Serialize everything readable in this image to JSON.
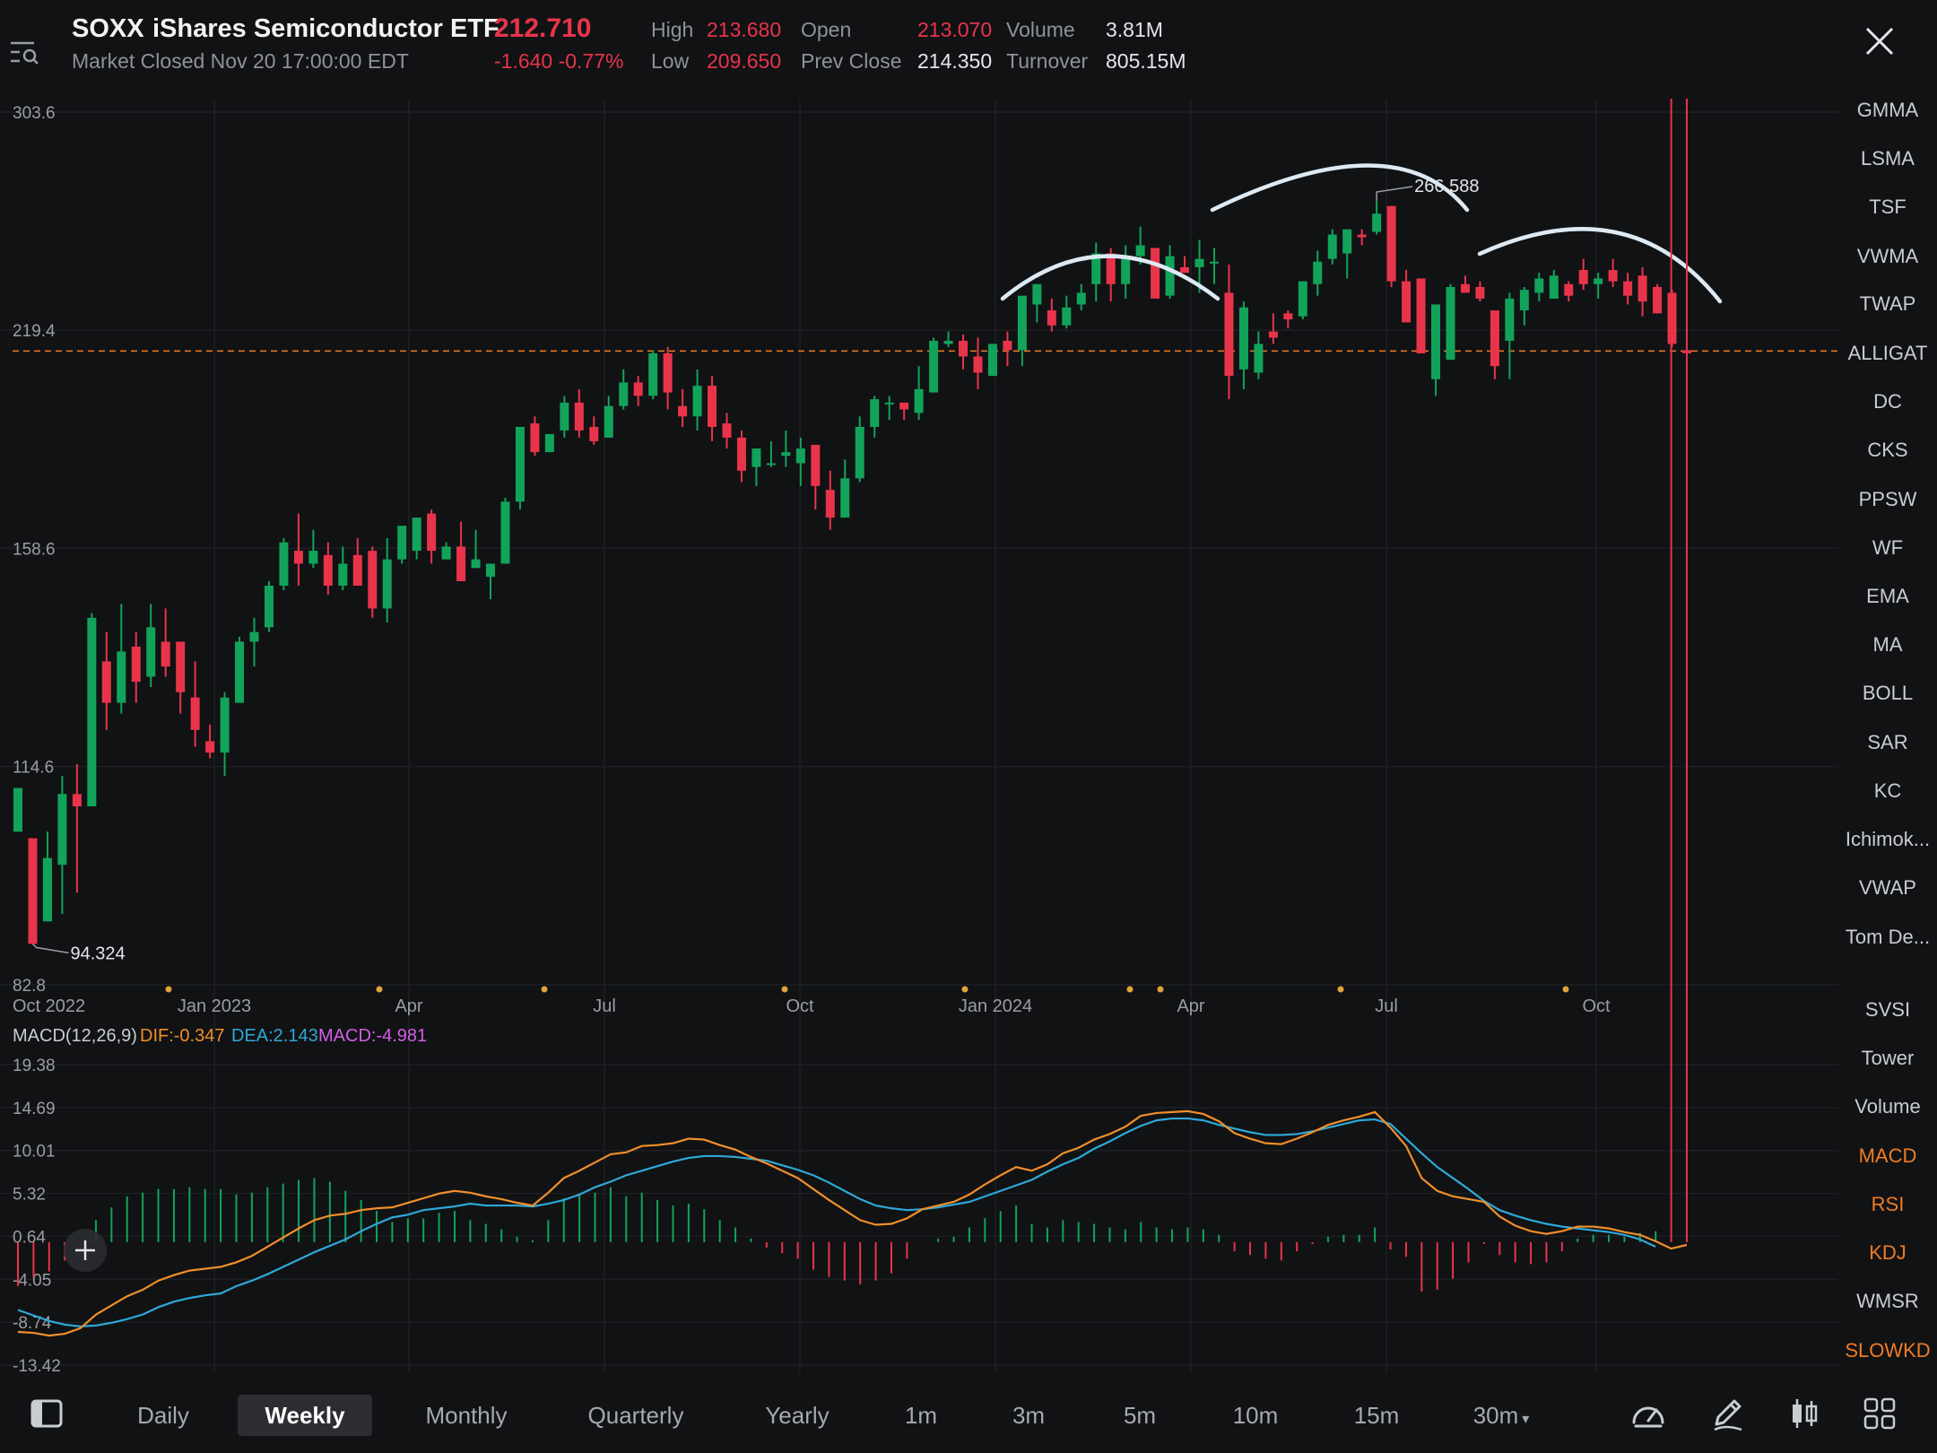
{
  "header": {
    "symbol": "SOXX",
    "name": "iShares Semiconductor ETF",
    "price": "212.710",
    "status": "Market Closed Nov 20 17:00:00 EDT",
    "change": "-1.640 -0.77%",
    "stats": [
      {
        "label": "High",
        "value": "213.680",
        "color": "#e8344b"
      },
      {
        "label": "Low",
        "value": "209.650",
        "color": "#e8344b"
      },
      {
        "label": "Open",
        "value": "213.070",
        "color": "#e8344b"
      },
      {
        "label": "Prev Close",
        "value": "214.350",
        "color": "#e4e6ea"
      },
      {
        "label": "Volume",
        "value": "3.81M",
        "color": "#e4e6ea"
      },
      {
        "label": "Turnover",
        "value": "805.15M",
        "color": "#e4e6ea"
      }
    ]
  },
  "colors": {
    "up": "#12a35a",
    "down": "#e8344b",
    "accent": "#f07c24",
    "dif": "#f08f2a",
    "dea": "#2ea8d8",
    "macd": "#d35ee3"
  },
  "chart_data": [
    {
      "type": "candlestick",
      "series_name": "SOXX Weekly",
      "y_ticks": [
        "303.6",
        "219.4",
        "158.6",
        "114.6",
        "82.8"
      ],
      "x_ticks": [
        "Oct 2022",
        "Jan 2023",
        "Apr",
        "Jul",
        "Oct",
        "Jan 2024",
        "Apr",
        "Jul",
        "Oct"
      ],
      "price_line": 212.71,
      "high_label": "266.588",
      "low_label": "94.324",
      "ohlc": [
        [
          104,
          111,
          104,
          111
        ],
        [
          103,
          103,
          88,
          88
        ],
        [
          91,
          104,
          91,
          100
        ],
        [
          99,
          113,
          92,
          110
        ],
        [
          110,
          115,
          95,
          108
        ],
        [
          108,
          144,
          108,
          143
        ],
        [
          134,
          140,
          121,
          126
        ],
        [
          126,
          146,
          124,
          136
        ],
        [
          137,
          140,
          126,
          130
        ],
        [
          131,
          146,
          129,
          141
        ],
        [
          138,
          145,
          131,
          133
        ],
        [
          138,
          138,
          124,
          128
        ],
        [
          127,
          134,
          118,
          121
        ],
        [
          119,
          122,
          116,
          117
        ],
        [
          117,
          128,
          113,
          127
        ],
        [
          126,
          139,
          126,
          138
        ],
        [
          138,
          143,
          133,
          140
        ],
        [
          141,
          151,
          140,
          150
        ],
        [
          150,
          161,
          149,
          160
        ],
        [
          158,
          167,
          150,
          155
        ],
        [
          155,
          163,
          154,
          158
        ],
        [
          157,
          160,
          148,
          150
        ],
        [
          150,
          159,
          149,
          155
        ],
        [
          157,
          161,
          150,
          150
        ],
        [
          158,
          159,
          143,
          145
        ],
        [
          145,
          161,
          142,
          156
        ],
        [
          156,
          164,
          155,
          164
        ],
        [
          158,
          166,
          156,
          166
        ],
        [
          167,
          168,
          155,
          158
        ],
        [
          156,
          160,
          156,
          159
        ],
        [
          159,
          165,
          151,
          151
        ],
        [
          154,
          163,
          154,
          156
        ],
        [
          152,
          153,
          147,
          155
        ],
        [
          155,
          171,
          155,
          170
        ],
        [
          170,
          190,
          168,
          190
        ],
        [
          191,
          193,
          182,
          183
        ],
        [
          183,
          185,
          183,
          188
        ],
        [
          189,
          199,
          187,
          197
        ],
        [
          197,
          201,
          187,
          189
        ],
        [
          190,
          193,
          185,
          186
        ],
        [
          187,
          199,
          187,
          196
        ],
        [
          196,
          207,
          195,
          203
        ],
        [
          203,
          205,
          196,
          199
        ],
        [
          199,
          213,
          198,
          212
        ],
        [
          212,
          214,
          195,
          200
        ],
        [
          196,
          201,
          190,
          193
        ],
        [
          193,
          207,
          189,
          202
        ],
        [
          202,
          205,
          186,
          190
        ],
        [
          191,
          194,
          184,
          187
        ],
        [
          187,
          189,
          175,
          178
        ],
        [
          179,
          183,
          174,
          184
        ],
        [
          180,
          186,
          179,
          180
        ],
        [
          182,
          189,
          179,
          183
        ],
        [
          180,
          187,
          174,
          184
        ],
        [
          185,
          185,
          168,
          174
        ],
        [
          173,
          178,
          163,
          166
        ],
        [
          166,
          181,
          166,
          176
        ],
        [
          176,
          193,
          175,
          190
        ],
        [
          190,
          199,
          187,
          198
        ],
        [
          197,
          199,
          192,
          197
        ],
        [
          197,
          197,
          192,
          195
        ],
        [
          194,
          208,
          192,
          201
        ],
        [
          200,
          217,
          200,
          216
        ],
        [
          215,
          219,
          214,
          216
        ],
        [
          216,
          218,
          207,
          211
        ],
        [
          211,
          217,
          201,
          206
        ],
        [
          205,
          215,
          205,
          215
        ],
        [
          216,
          219,
          208,
          213
        ],
        [
          213,
          229,
          208,
          231
        ],
        [
          228,
          233,
          222,
          235
        ],
        [
          226,
          230,
          219,
          221
        ],
        [
          221,
          231,
          220,
          227
        ],
        [
          228,
          235,
          226,
          232
        ],
        [
          235,
          250,
          229,
          246
        ],
        [
          246,
          248,
          229,
          235
        ],
        [
          235,
          249,
          230,
          245
        ],
        [
          245,
          256,
          242,
          249
        ],
        [
          248,
          248,
          230,
          230
        ],
        [
          231,
          249,
          230,
          245
        ],
        [
          241,
          245,
          241,
          239
        ],
        [
          241,
          251,
          232,
          244
        ],
        [
          243,
          248,
          235,
          243
        ],
        [
          232,
          242,
          198,
          205
        ],
        [
          207,
          229,
          201,
          227
        ],
        [
          206,
          219,
          204,
          215
        ],
        [
          219,
          225,
          215,
          217
        ],
        [
          225,
          226,
          220,
          223
        ],
        [
          224,
          236,
          223,
          236
        ],
        [
          235,
          247,
          231,
          243
        ],
        [
          244,
          255,
          242,
          253
        ],
        [
          246,
          255,
          237,
          255
        ],
        [
          253,
          255,
          249,
          252
        ],
        [
          254,
          266,
          253,
          261
        ],
        [
          264,
          264,
          234,
          236
        ],
        [
          236,
          240,
          222,
          222
        ],
        [
          237,
          237,
          212,
          212
        ],
        [
          204,
          228,
          199,
          228
        ],
        [
          210,
          235,
          210,
          234
        ],
        [
          235,
          238,
          233,
          232
        ],
        [
          234,
          236,
          229,
          230
        ],
        [
          226,
          226,
          204,
          208
        ],
        [
          216,
          232,
          204,
          230
        ],
        [
          226,
          234,
          221,
          233
        ],
        [
          232,
          239,
          229,
          237
        ],
        [
          230,
          240,
          230,
          238
        ],
        [
          235,
          236,
          229,
          231
        ],
        [
          240,
          244,
          233,
          235
        ],
        [
          235,
          239,
          230,
          237
        ],
        [
          240,
          244,
          234,
          236
        ],
        [
          236,
          239,
          228,
          231
        ],
        [
          238,
          241,
          224,
          229
        ],
        [
          234,
          235,
          225,
          225
        ],
        [
          232,
          233,
          214,
          215
        ],
        [
          213,
          215,
          209,
          212
        ]
      ]
    },
    {
      "type": "line+bar",
      "title": "MACD(12,26,9)",
      "dif_label": "DIF:-0.347",
      "dea_label": "DEA:2.143",
      "macd_label": "MACD:-4.981",
      "y_ticks": [
        "19.38",
        "14.69",
        "10.01",
        "5.32",
        "0.64",
        "-4.05",
        "-8.74",
        "-13.42"
      ],
      "dif": [
        -9.8,
        -9.9,
        -10.2,
        -10.0,
        -9.4,
        -7.9,
        -6.9,
        -5.9,
        -5.2,
        -4.2,
        -3.6,
        -3.1,
        -2.9,
        -2.7,
        -2.2,
        -1.5,
        -0.5,
        0.5,
        1.5,
        2.4,
        2.9,
        3.1,
        3.5,
        3.7,
        3.8,
        4.3,
        4.8,
        5.3,
        5.6,
        5.4,
        5.0,
        4.7,
        4.3,
        4.0,
        5.4,
        7.0,
        7.8,
        8.7,
        9.6,
        9.8,
        10.5,
        10.6,
        10.8,
        11.3,
        11.2,
        10.6,
        10.1,
        9.3,
        8.6,
        7.8,
        7.0,
        5.8,
        4.6,
        3.5,
        2.4,
        1.9,
        2.0,
        2.6,
        3.6,
        4.0,
        4.4,
        5.2,
        6.3,
        7.3,
        8.2,
        7.8,
        8.5,
        9.7,
        10.3,
        11.2,
        11.8,
        12.6,
        13.8,
        14.1,
        14.2,
        14.3,
        14.0,
        13.2,
        11.9,
        11.3,
        10.8,
        10.7,
        11.3,
        12.0,
        12.8,
        13.3,
        13.7,
        14.2,
        12.5,
        10.5,
        7.0,
        5.6,
        5.0,
        4.7,
        4.4,
        2.8,
        1.8,
        1.2,
        0.9,
        1.2,
        1.7,
        1.7,
        1.5,
        1.1,
        0.8,
        0.1,
        -0.7,
        -0.3
      ],
      "dea": [
        -7.4,
        -8.0,
        -8.6,
        -9.0,
        -9.2,
        -9.1,
        -8.8,
        -8.4,
        -7.9,
        -7.1,
        -6.5,
        -6.1,
        -5.8,
        -5.6,
        -4.8,
        -4.2,
        -3.5,
        -2.7,
        -1.9,
        -1.1,
        -0.4,
        0.3,
        1.2,
        2.0,
        2.7,
        3.0,
        3.5,
        3.7,
        3.9,
        4.2,
        4.0,
        4.0,
        4.0,
        3.9,
        4.2,
        4.6,
        5.2,
        6.0,
        6.6,
        7.3,
        7.8,
        8.3,
        8.8,
        9.2,
        9.4,
        9.4,
        9.3,
        9.1,
        8.9,
        8.4,
        7.9,
        7.3,
        6.5,
        5.6,
        4.7,
        4.0,
        3.7,
        3.5,
        3.6,
        3.8,
        4.1,
        4.4,
        5.0,
        5.6,
        6.2,
        6.8,
        7.7,
        8.5,
        9.2,
        10.2,
        11.0,
        11.9,
        12.7,
        13.3,
        13.5,
        13.5,
        13.3,
        12.8,
        12.4,
        12.0,
        11.7,
        11.7,
        11.8,
        12.1,
        12.5,
        12.9,
        13.3,
        13.4,
        12.9,
        11.3,
        9.7,
        8.2,
        7.0,
        5.8,
        4.5,
        3.5,
        2.9,
        2.4,
        2.0,
        1.7,
        1.5,
        1.3,
        1.1,
        0.8,
        0.3,
        -0.5
      ]
    }
  ],
  "side_indicators": [
    {
      "label": "GMMA",
      "active": false
    },
    {
      "label": "LSMA",
      "active": false
    },
    {
      "label": "TSF",
      "active": false
    },
    {
      "label": "VWMA",
      "active": false
    },
    {
      "label": "TWAP",
      "active": false
    },
    {
      "label": "ALLIGAT",
      "active": false
    },
    {
      "label": "DC",
      "active": false
    },
    {
      "label": "CKS",
      "active": false
    },
    {
      "label": "PPSW",
      "active": false
    },
    {
      "label": "WF",
      "active": false
    },
    {
      "label": "EMA",
      "active": false
    },
    {
      "label": "MA",
      "active": false
    },
    {
      "label": "BOLL",
      "active": false
    },
    {
      "label": "SAR",
      "active": false
    },
    {
      "label": "KC",
      "active": false
    },
    {
      "label": "Ichimok...",
      "active": false
    },
    {
      "label": "VWAP",
      "active": false
    },
    {
      "label": "Tom De...",
      "active": false
    },
    {
      "label": "SVSI",
      "active": false
    },
    {
      "label": "Tower",
      "active": false
    },
    {
      "label": "Volume",
      "active": false
    },
    {
      "label": "MACD",
      "active": true
    },
    {
      "label": "RSI",
      "active": true
    },
    {
      "label": "KDJ",
      "active": true
    },
    {
      "label": "WMSR",
      "active": false
    },
    {
      "label": "SLOWKD",
      "active": true
    }
  ],
  "periods": [
    {
      "label": "Daily",
      "selected": false
    },
    {
      "label": "Weekly",
      "selected": true
    },
    {
      "label": "Monthly",
      "selected": false
    },
    {
      "label": "Quarterly",
      "selected": false
    },
    {
      "label": "Yearly",
      "selected": false
    },
    {
      "label": "1m",
      "selected": false
    },
    {
      "label": "3m",
      "selected": false
    },
    {
      "label": "5m",
      "selected": false
    },
    {
      "label": "10m",
      "selected": false
    },
    {
      "label": "15m",
      "selected": false
    },
    {
      "label": "30m",
      "selected": false
    }
  ],
  "icons": {
    "menu": "menu-search-icon",
    "close": "close-icon",
    "sidebar_toggle": "sidebar-toggle-icon",
    "speed": "speedometer-icon",
    "draw": "pen-draw-icon",
    "candles": "candlestick-icon",
    "grid": "grid-icon"
  }
}
